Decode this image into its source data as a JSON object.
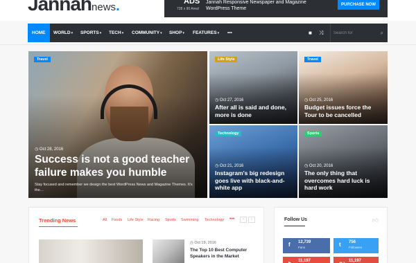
{
  "header": {
    "logo_main": "Jannah",
    "logo_suffix": "news",
    "logo_dot": ".",
    "ad_label": "ADS",
    "ad_size": "728 x 90 Area!",
    "ad_text": "Jannah Responsive Newspaper and Magazine WordPress Theme",
    "ad_button": "PURCHASE NOW"
  },
  "nav": {
    "items": [
      {
        "label": "HOME"
      },
      {
        "label": "WORLD"
      },
      {
        "label": "SPORTS"
      },
      {
        "label": "TECH"
      },
      {
        "label": "COMMUNITY"
      },
      {
        "label": "SHOP"
      },
      {
        "label": "FEATURES"
      }
    ],
    "more_label": "•••",
    "search_placeholder": "Search for"
  },
  "featured": {
    "main": {
      "tag": "Travel",
      "date": "Oct 28, 2016",
      "title": "Success is not a good teacher failure makes you humble",
      "excerpt": "Stay focused and remember we design the best WordPress News and Magazine Themes. It's the…",
      "tag_color": "#0088ff"
    },
    "cards": [
      {
        "tag": "Life Style",
        "date": "Oct 27, 2016",
        "title": "After all is said and done, more is done",
        "tag_color": "#d4a017"
      },
      {
        "tag": "Travel",
        "date": "Oct 25, 2016",
        "title": "Budget issues force the Tour to be cancelled",
        "tag_color": "#0088ff"
      },
      {
        "tag": "Technology",
        "date": "Oct 21, 2016",
        "title": "Instagram's big redesign goes live with black-and-white app",
        "tag_color": "#2eb5c7"
      },
      {
        "tag": "Sports",
        "date": "Oct 20, 2016",
        "title": "The only thing that overcomes hard luck is hard work",
        "tag_color": "#2ecc71"
      }
    ]
  },
  "trending": {
    "title": "Trending News",
    "tabs": [
      "All",
      "Foods",
      "Life Style",
      "Racing",
      "Sports",
      "Swimming",
      "Technology"
    ],
    "more": "•••",
    "prev": "‹",
    "next": "›",
    "post_date": "Oct 19, 2016",
    "post_title": "The Top 10 Best Computer Speakers in the Market"
  },
  "follow": {
    "title": "Follow Us",
    "social": [
      {
        "network": "facebook",
        "icon": "f",
        "count": "12,739",
        "label": "Fans"
      },
      {
        "network": "twitter",
        "icon": "t",
        "count": "756",
        "label": "Followers"
      },
      {
        "network": "youtube",
        "icon": "▶",
        "count": "11,197",
        "label": ""
      },
      {
        "network": "google-plus",
        "icon": "g+",
        "count": "11,197",
        "label": ""
      }
    ]
  },
  "colors": {
    "accent": "#0088ff",
    "trending": "#e84c3d",
    "nav_bg": "#2c2f34"
  }
}
